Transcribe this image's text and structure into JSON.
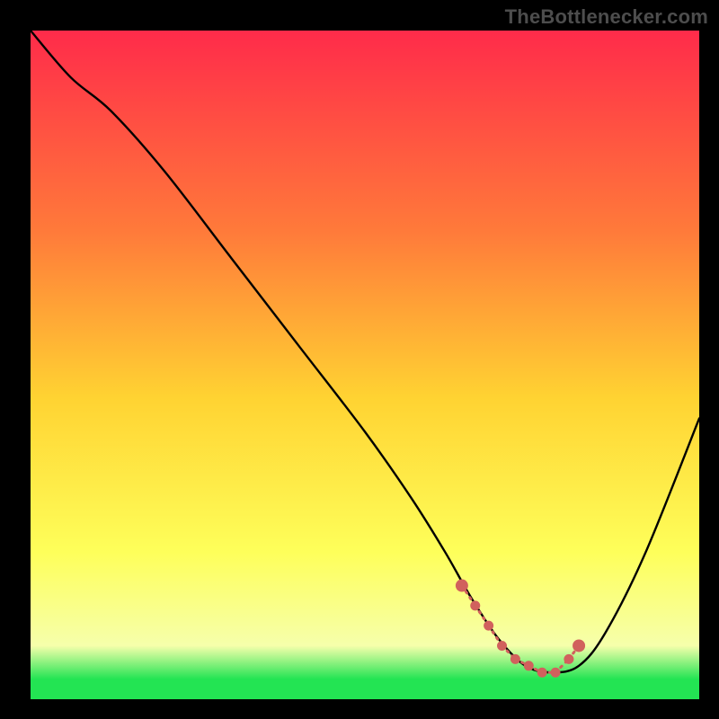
{
  "attribution": "TheBottlenecker.com",
  "colors": {
    "frame_bg": "#000000",
    "gradient_top": "#ff2b4a",
    "gradient_mid1": "#ff7a3a",
    "gradient_mid2": "#ffd332",
    "gradient_mid3": "#feff5a",
    "gradient_bottom_yellow": "#f6ffab",
    "gradient_green": "#23e453",
    "curve_stroke": "#000000",
    "dot_fill": "#d1615d",
    "dot_stroke": "#d1615d"
  },
  "chart_data": {
    "type": "line",
    "title": "",
    "xlabel": "",
    "ylabel": "",
    "xlim": [
      0,
      100
    ],
    "ylim": [
      0,
      100
    ],
    "series": [
      {
        "name": "bottleneck-curve",
        "x": [
          0,
          6,
          12,
          20,
          30,
          40,
          50,
          57,
          62,
          66,
          70,
          74,
          78,
          82,
          86,
          92,
          100
        ],
        "y": [
          100,
          93,
          88,
          79,
          66,
          53,
          40,
          30,
          22,
          15,
          9,
          5,
          4,
          5,
          10,
          22,
          42
        ]
      }
    ],
    "highlight_points": {
      "name": "flat-bottom-dots",
      "x": [
        64.5,
        66.5,
        68.5,
        70.5,
        72.5,
        74.5,
        76.5,
        78.5,
        80.5,
        82.0
      ],
      "y": [
        17,
        14,
        11,
        8,
        6,
        5,
        4,
        4,
        6,
        8
      ]
    }
  }
}
